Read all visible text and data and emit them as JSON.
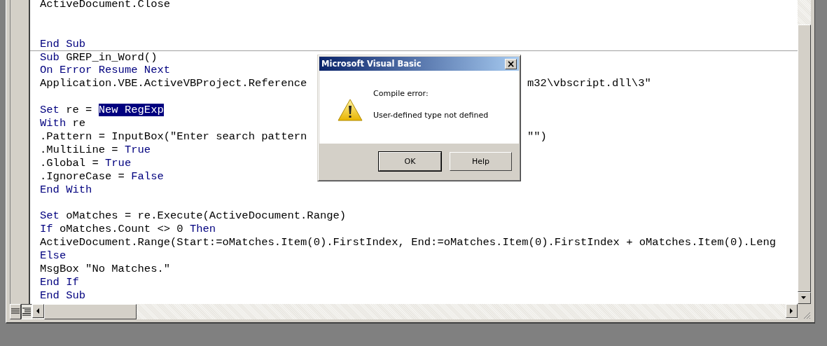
{
  "code_lines": [
    {
      "tokens": [
        {
          "kind": "plain",
          "text": "ActiveDocument.Close"
        }
      ],
      "blank_after": true
    },
    {
      "tokens": [
        {
          "kind": "keyword",
          "text": "End Sub"
        }
      ],
      "blank_before": true
    },
    {
      "procedure_start": true,
      "tokens": [
        {
          "kind": "keyword",
          "text": "Sub"
        },
        {
          "kind": "plain",
          "text": " GREP_in_Word()"
        }
      ]
    },
    {
      "tokens": [
        {
          "kind": "keyword",
          "text": "On Error Resume Next"
        }
      ]
    },
    {
      "tokens": [
        {
          "kind": "plain",
          "text": "Application.VBE.ActiveVBProject.Reference"
        }
      ],
      "after_dialog": "m32\\vbscript.dll\\3\"",
      "blank_after": true
    },
    {
      "tokens": [
        {
          "kind": "keyword",
          "text": "Set"
        },
        {
          "kind": "plain",
          "text": " re = "
        },
        {
          "kind": "selected",
          "text": "New RegExp"
        }
      ]
    },
    {
      "tokens": [
        {
          "kind": "keyword",
          "text": "With"
        },
        {
          "kind": "plain",
          "text": " re"
        }
      ]
    },
    {
      "tokens": [
        {
          "kind": "plain",
          "text": ".Pattern = InputBox(\"Enter search pattern"
        }
      ],
      "after_dialog": "\"\")"
    },
    {
      "tokens": [
        {
          "kind": "plain",
          "text": ".MultiLine = "
        },
        {
          "kind": "keyword",
          "text": "True"
        }
      ]
    },
    {
      "tokens": [
        {
          "kind": "plain",
          "text": ".Global = "
        },
        {
          "kind": "keyword",
          "text": "True"
        }
      ]
    },
    {
      "tokens": [
        {
          "kind": "plain",
          "text": ".IgnoreCase = "
        },
        {
          "kind": "keyword",
          "text": "False"
        }
      ]
    },
    {
      "tokens": [
        {
          "kind": "keyword",
          "text": "End With"
        }
      ],
      "blank_after": true
    },
    {
      "tokens": [
        {
          "kind": "keyword",
          "text": "Set"
        },
        {
          "kind": "plain",
          "text": " oMatches = re.Execute(ActiveDocument.Range)"
        }
      ]
    },
    {
      "tokens": [
        {
          "kind": "keyword",
          "text": "If"
        },
        {
          "kind": "plain",
          "text": " oMatches.Count <> 0 "
        },
        {
          "kind": "keyword",
          "text": "Then"
        }
      ]
    },
    {
      "tokens": [
        {
          "kind": "plain",
          "text": "ActiveDocument.Range(Start:=oMatches.Item(0).FirstIndex, End:=oMatches.Item(0).FirstIndex + oMatches.Item(0).Leng"
        }
      ]
    },
    {
      "tokens": [
        {
          "kind": "keyword",
          "text": "Else"
        }
      ]
    },
    {
      "tokens": [
        {
          "kind": "plain",
          "text": "MsgBox \"No Matches.\""
        }
      ]
    },
    {
      "tokens": [
        {
          "kind": "keyword",
          "text": "End If"
        }
      ]
    },
    {
      "tokens": [
        {
          "kind": "keyword",
          "text": "End Sub"
        }
      ]
    }
  ],
  "dialog": {
    "title": "Microsoft Visual Basic",
    "close": "×",
    "heading": "Compile error:",
    "message": "User-defined type not defined",
    "buttons": [
      {
        "label": "OK",
        "default": true
      },
      {
        "label": "Help",
        "default": false
      }
    ]
  }
}
